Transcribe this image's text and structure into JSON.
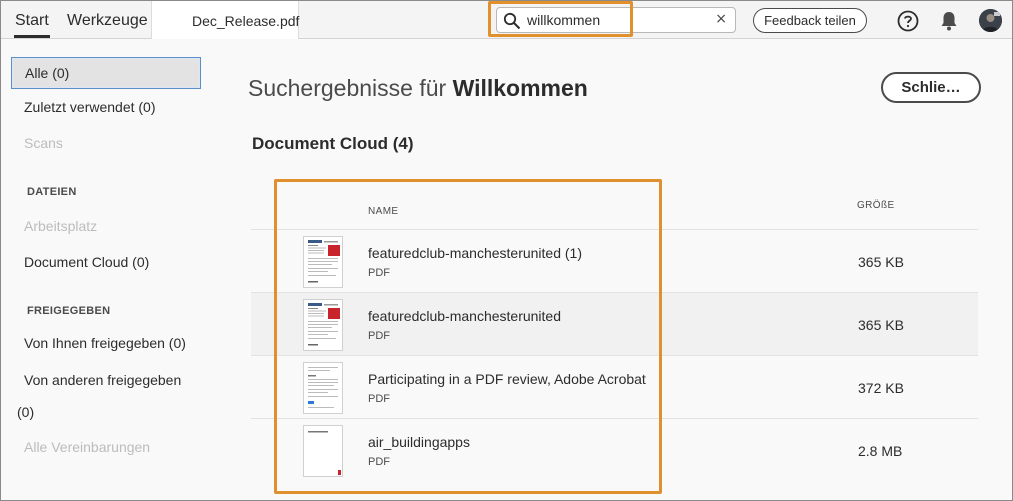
{
  "header": {
    "tabs": [
      {
        "label": "Start"
      },
      {
        "label": "Werkzeuge"
      }
    ],
    "document_tab": "Dec_Release.pdf",
    "search": {
      "value": "willkommen",
      "clear_icon": "×"
    },
    "feedback_label": "Feedback teilen",
    "icons": [
      "search-icon",
      "close-icon",
      "help-icon",
      "bell-icon",
      "avatar"
    ]
  },
  "sidebar": {
    "items": [
      {
        "label": "Alle (0)"
      },
      {
        "label": "Zuletzt verwendet (0)"
      },
      {
        "label": "Scans"
      }
    ],
    "files_heading": "DATEIEN",
    "files": [
      {
        "label": "Arbeitsplatz"
      },
      {
        "label": "Document Cloud (0)"
      }
    ],
    "shared_heading": "FREIGEGEBEN",
    "shared": [
      {
        "label": "Von Ihnen freigegeben (0)"
      },
      {
        "label": "Von anderen freigegeben"
      },
      {
        "label": "(0)"
      },
      {
        "label": "Alle Vereinbarungen"
      }
    ]
  },
  "main": {
    "title_prefix": "Suchergebnisse für",
    "title_query": "Willkommen",
    "close_label": "Schlie…",
    "section_title": "Document Cloud (4)",
    "columns": {
      "name": "NAME",
      "size": "GRÖßE"
    },
    "files": [
      {
        "name": "featuredclub-manchesterunited (1)",
        "type": "PDF",
        "size": "365 KB"
      },
      {
        "name": "featuredclub-manchesterunited",
        "type": "PDF",
        "size": "365 KB"
      },
      {
        "name": "Participating in a PDF review, Adobe Acrobat",
        "type": "PDF",
        "size": "372 KB"
      },
      {
        "name": "air_buildingapps",
        "type": "PDF",
        "size": "2.8 MB"
      }
    ]
  },
  "colors": {
    "highlight": "#e0902d",
    "selected_border": "#5a8fc8",
    "selected_bg": "#e3e3e3",
    "thumb_accent": "#c8242b"
  }
}
